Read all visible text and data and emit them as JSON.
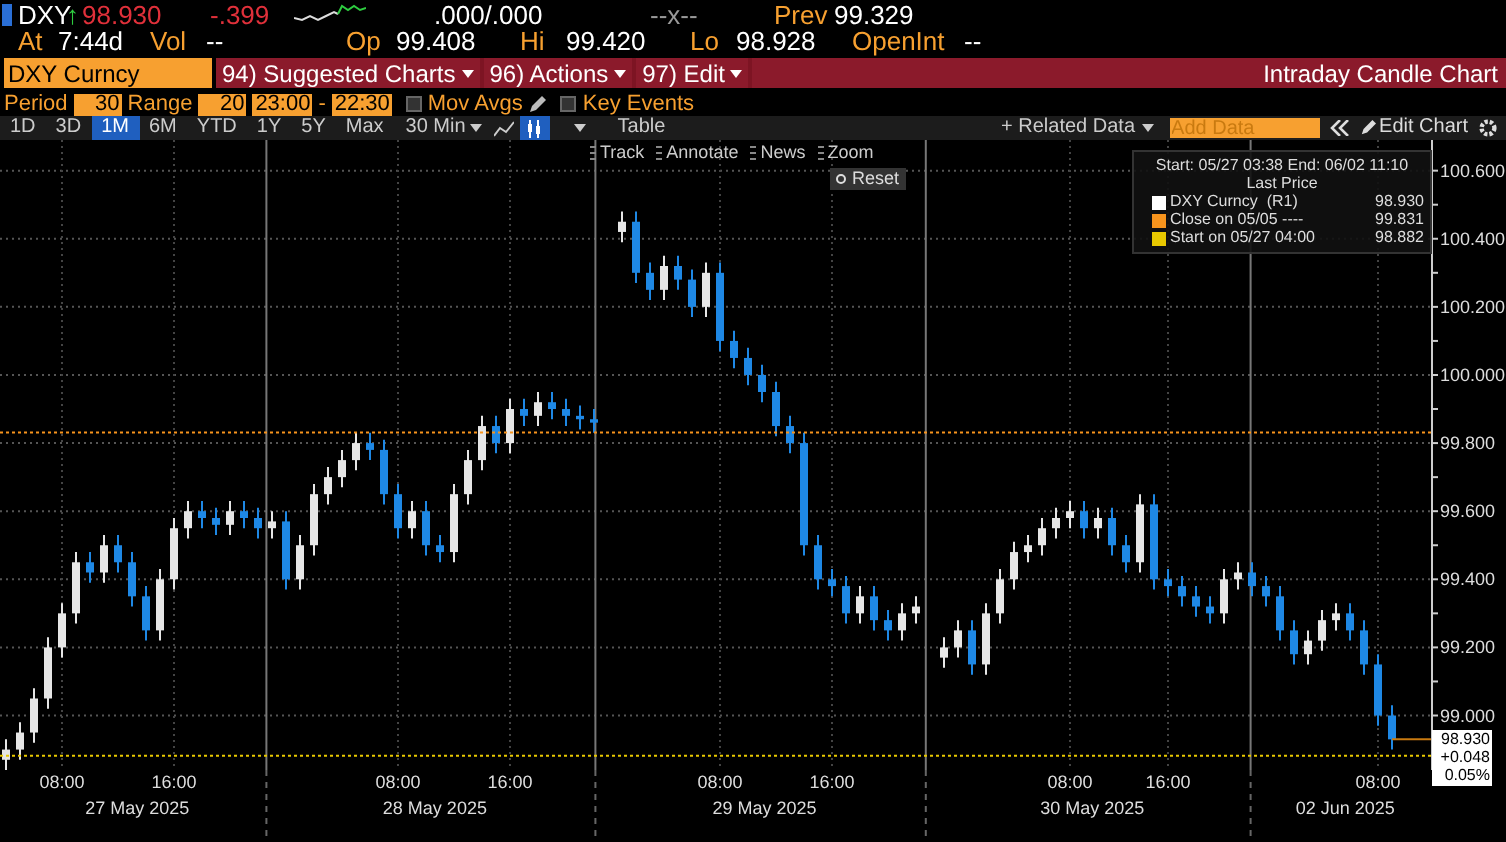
{
  "header": {
    "ticker": "DXY",
    "arrow": "↑",
    "last": "98.930",
    "change": "-.399",
    "bid_ask": ".000/.000",
    "size": "--x--",
    "prev_label": "Prev",
    "prev": "99.329"
  },
  "stats": [
    {
      "label": "At",
      "value": "7:44d"
    },
    {
      "label": "Vol",
      "value": "--"
    },
    {
      "label": "Op",
      "value": "99.408"
    },
    {
      "label": "Hi",
      "value": "99.420"
    },
    {
      "label": "Lo",
      "value": "98.928"
    },
    {
      "label": "OpenInt",
      "value": "--"
    }
  ],
  "security_field": {
    "value": "DXY Curncy"
  },
  "menu_buttons": [
    {
      "number": "94)",
      "label": "Suggested Charts"
    },
    {
      "number": "96)",
      "label": "Actions"
    },
    {
      "number": "97)",
      "label": "Edit"
    }
  ],
  "chart_title": "Intraday Candle Chart",
  "settings": {
    "period_label": "Period",
    "period": "30",
    "range_label": "Range",
    "range": "20",
    "start": "23:00",
    "separator": "-",
    "end": "22:30",
    "options": [
      {
        "label": "Mov Avgs",
        "checked": false
      },
      {
        "label": "Key Events",
        "checked": false
      }
    ]
  },
  "ranges": [
    {
      "label": "1D",
      "selected": false
    },
    {
      "label": "3D",
      "selected": false
    },
    {
      "label": "1M",
      "selected": true
    },
    {
      "label": "6M",
      "selected": false
    },
    {
      "label": "YTD",
      "selected": false
    },
    {
      "label": "1Y",
      "selected": false
    },
    {
      "label": "5Y",
      "selected": false
    },
    {
      "label": "Max",
      "selected": false
    }
  ],
  "interval": "30 Min",
  "chart_styles": [
    {
      "kind": "line",
      "selected": false
    },
    {
      "kind": "candle",
      "selected": true
    }
  ],
  "table_button": "Table",
  "related_data": "+ Related Data",
  "add_data": {
    "placeholder": "Add Data"
  },
  "edit_chart": "Edit Chart",
  "chart_tools": [
    "Track",
    "Annotate",
    "News",
    "Zoom"
  ],
  "reset": "Reset",
  "legend": {
    "range": "Start: 05/27 03:38 End: 06/02 11:10",
    "heading": "Last Price",
    "items": [
      {
        "label": "DXY Curncy  (R1)",
        "value": "98.930",
        "color": "#ffffff"
      },
      {
        "label": "Close on 05/05 ----",
        "value": "99.831",
        "color": "#f7941d"
      },
      {
        "label": "Start on 05/27 04:00",
        "value": "98.882",
        "color": "#e8c800"
      }
    ]
  },
  "last_tag": [
    "98.930",
    "+0.048",
    "0.05%"
  ],
  "x_axis": {
    "dates": [
      "27 May 2025",
      "28 May 2025",
      "29 May 2025",
      "30 May 2025",
      "02 Jun 2025"
    ]
  },
  "chart_data": {
    "type": "candlestick",
    "grid": true,
    "ylim": [
      98.84,
      100.69
    ],
    "ref_lines": [
      {
        "axis": "y",
        "value": 99.831,
        "color": "#f7941d"
      },
      {
        "axis": "y",
        "value": 98.882,
        "color": "#e8c800"
      }
    ],
    "yticks": [
      {
        "value": 99,
        "label": "99.000"
      },
      {
        "value": 99.2,
        "label": "99.200"
      },
      {
        "value": 99.4,
        "label": "99.400"
      },
      {
        "value": 99.6,
        "label": "99.600"
      },
      {
        "value": 99.8,
        "label": "99.800"
      },
      {
        "value": 100,
        "label": "100.000"
      },
      {
        "value": 100.2,
        "label": "100.200"
      },
      {
        "value": 100.4,
        "label": "100.400"
      },
      {
        "value": 100.6,
        "label": "100.600"
      }
    ],
    "categories": [
      null,
      null,
      null,
      null,
      "08:00",
      null,
      null,
      null,
      null,
      null,
      null,
      null,
      "16:00",
      null,
      null,
      null,
      null,
      null,
      null,
      null,
      null,
      null,
      null,
      null,
      null,
      null,
      null,
      null,
      "08:00",
      null,
      null,
      null,
      null,
      null,
      null,
      null,
      "16:00",
      null,
      null,
      null,
      null,
      null,
      null,
      null,
      null,
      null,
      null,
      null,
      null,
      null,
      null,
      "08:00",
      null,
      null,
      null,
      null,
      null,
      null,
      null,
      "16:00",
      null,
      null,
      null,
      null,
      null,
      null,
      null,
      null,
      null,
      null,
      null,
      null,
      null,
      null,
      null,
      null,
      "08:00",
      null,
      null,
      null,
      null,
      null,
      null,
      "16:00",
      null,
      null,
      null,
      null,
      null,
      null,
      null,
      null,
      null,
      null,
      null,
      null,
      null,
      null,
      "08:00",
      null
    ],
    "ohlc": [
      [
        98.87,
        98.93,
        98.84,
        98.9
      ],
      [
        98.9,
        98.98,
        98.87,
        98.95
      ],
      [
        98.95,
        99.08,
        98.92,
        99.05
      ],
      [
        99.05,
        99.23,
        99.02,
        99.2
      ],
      [
        99.2,
        99.33,
        99.17,
        99.3
      ],
      [
        99.3,
        99.48,
        99.27,
        99.45
      ],
      [
        99.45,
        99.48,
        99.39,
        99.42
      ],
      [
        99.42,
        99.53,
        99.39,
        99.5
      ],
      [
        99.5,
        99.53,
        99.42,
        99.45
      ],
      [
        99.45,
        99.48,
        99.32,
        99.35
      ],
      [
        99.35,
        99.38,
        99.22,
        99.25
      ],
      [
        99.25,
        99.43,
        99.22,
        99.4
      ],
      [
        99.4,
        99.58,
        99.37,
        99.55
      ],
      [
        99.55,
        99.63,
        99.52,
        99.6
      ],
      [
        99.6,
        99.63,
        99.55,
        99.58
      ],
      [
        99.58,
        99.61,
        99.53,
        99.56
      ],
      [
        99.56,
        99.63,
        99.53,
        99.6
      ],
      [
        99.6,
        99.63,
        99.55,
        99.58
      ],
      [
        99.58,
        99.61,
        99.52,
        99.55
      ],
      [
        99.55,
        99.6,
        99.52,
        99.57
      ],
      [
        99.57,
        99.6,
        99.37,
        99.4
      ],
      [
        99.4,
        99.53,
        99.37,
        99.5
      ],
      [
        99.5,
        99.68,
        99.47,
        99.65
      ],
      [
        99.65,
        99.73,
        99.62,
        99.7
      ],
      [
        99.7,
        99.78,
        99.67,
        99.75
      ],
      [
        99.75,
        99.83,
        99.72,
        99.8
      ],
      [
        99.8,
        99.83,
        99.75,
        99.78
      ],
      [
        99.78,
        99.81,
        99.62,
        99.65
      ],
      [
        99.65,
        99.68,
        99.52,
        99.55
      ],
      [
        99.55,
        99.63,
        99.52,
        99.6
      ],
      [
        99.6,
        99.63,
        99.47,
        99.5
      ],
      [
        99.5,
        99.53,
        99.45,
        99.48
      ],
      [
        99.48,
        99.68,
        99.45,
        99.65
      ],
      [
        99.65,
        99.78,
        99.62,
        99.75
      ],
      [
        99.75,
        99.88,
        99.72,
        99.85
      ],
      [
        99.85,
        99.88,
        99.77,
        99.8
      ],
      [
        99.8,
        99.93,
        99.77,
        99.9
      ],
      [
        99.9,
        99.93,
        99.85,
        99.88
      ],
      [
        99.88,
        99.95,
        99.85,
        99.92
      ],
      [
        99.92,
        99.95,
        99.87,
        99.9
      ],
      [
        99.9,
        99.93,
        99.85,
        99.88
      ],
      [
        99.88,
        99.91,
        99.84,
        99.87
      ],
      [
        99.87,
        99.9,
        99.83,
        99.86
      ],
      null,
      [
        100.42,
        100.48,
        100.39,
        100.45
      ],
      [
        100.45,
        100.48,
        100.27,
        100.3
      ],
      [
        100.3,
        100.33,
        100.22,
        100.25
      ],
      [
        100.25,
        100.35,
        100.22,
        100.32
      ],
      [
        100.32,
        100.35,
        100.25,
        100.28
      ],
      [
        100.28,
        100.31,
        100.17,
        100.2
      ],
      [
        100.2,
        100.33,
        100.17,
        100.3
      ],
      [
        100.3,
        100.33,
        100.07,
        100.1
      ],
      [
        100.1,
        100.13,
        100.02,
        100.05
      ],
      [
        100.05,
        100.08,
        99.97,
        100.0
      ],
      [
        100.0,
        100.03,
        99.92,
        99.95
      ],
      [
        99.95,
        99.98,
        99.82,
        99.85
      ],
      [
        99.85,
        99.88,
        99.77,
        99.8
      ],
      [
        99.8,
        99.83,
        99.47,
        99.5
      ],
      [
        99.5,
        99.53,
        99.37,
        99.4
      ],
      [
        99.4,
        99.43,
        99.35,
        99.38
      ],
      [
        99.38,
        99.41,
        99.27,
        99.3
      ],
      [
        99.3,
        99.38,
        99.27,
        99.35
      ],
      [
        99.35,
        99.38,
        99.25,
        99.28
      ],
      [
        99.28,
        99.31,
        99.22,
        99.25
      ],
      [
        99.25,
        99.33,
        99.22,
        99.3
      ],
      [
        99.3,
        99.35,
        99.27,
        99.32
      ],
      null,
      [
        99.17,
        99.23,
        99.14,
        99.2
      ],
      [
        99.2,
        99.28,
        99.17,
        99.25
      ],
      [
        99.25,
        99.28,
        99.12,
        99.15
      ],
      [
        99.15,
        99.33,
        99.12,
        99.3
      ],
      [
        99.3,
        99.43,
        99.27,
        99.4
      ],
      [
        99.4,
        99.51,
        99.37,
        99.48
      ],
      [
        99.48,
        99.53,
        99.45,
        99.5
      ],
      [
        99.5,
        99.58,
        99.47,
        99.55
      ],
      [
        99.55,
        99.61,
        99.52,
        99.58
      ],
      [
        99.58,
        99.63,
        99.55,
        99.6
      ],
      [
        99.6,
        99.63,
        99.52,
        99.55
      ],
      [
        99.55,
        99.61,
        99.52,
        99.58
      ],
      [
        99.58,
        99.61,
        99.47,
        99.5
      ],
      [
        99.5,
        99.53,
        99.42,
        99.45
      ],
      [
        99.45,
        99.65,
        99.42,
        99.62
      ],
      [
        99.62,
        99.65,
        99.37,
        99.4
      ],
      [
        99.4,
        99.43,
        99.35,
        99.38
      ],
      [
        99.38,
        99.41,
        99.32,
        99.35
      ],
      [
        99.35,
        99.38,
        99.29,
        99.32
      ],
      [
        99.32,
        99.35,
        99.27,
        99.3
      ],
      [
        99.3,
        99.43,
        99.27,
        99.4
      ],
      [
        99.4,
        99.45,
        99.37,
        99.42
      ],
      [
        99.42,
        99.45,
        99.35,
        99.38
      ],
      [
        99.38,
        99.41,
        99.32,
        99.35
      ],
      [
        99.35,
        99.38,
        99.22,
        99.25
      ],
      [
        99.25,
        99.28,
        99.15,
        99.18
      ],
      [
        99.18,
        99.25,
        99.15,
        99.22
      ],
      [
        99.22,
        99.31,
        99.19,
        99.28
      ],
      [
        99.28,
        99.33,
        99.25,
        99.3
      ],
      [
        99.3,
        99.33,
        99.22,
        99.25
      ],
      [
        99.25,
        99.28,
        99.12,
        99.15
      ],
      [
        99.15,
        99.18,
        98.97,
        99.0
      ],
      [
        99.0,
        99.03,
        98.9,
        98.93
      ]
    ]
  }
}
